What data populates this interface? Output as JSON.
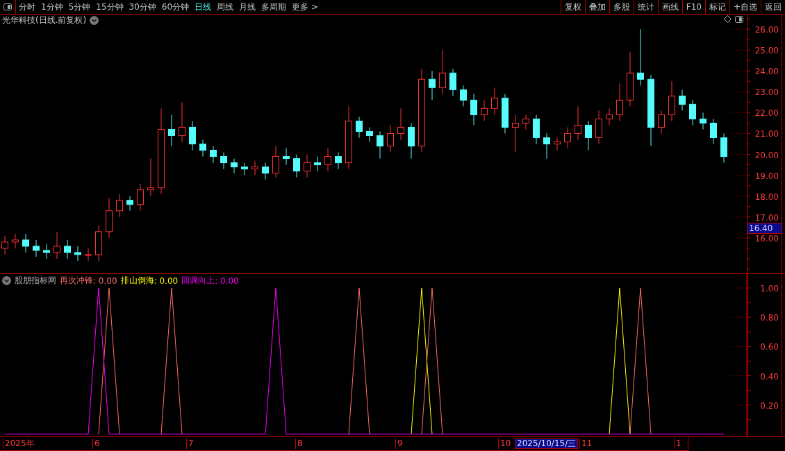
{
  "toolbar": {
    "tabs": [
      {
        "label": "分时",
        "selected": false
      },
      {
        "label": "1分钟",
        "selected": false
      },
      {
        "label": "5分钟",
        "selected": false
      },
      {
        "label": "15分钟",
        "selected": false
      },
      {
        "label": "30分钟",
        "selected": false
      },
      {
        "label": "60分钟",
        "selected": false
      },
      {
        "label": "日线",
        "selected": true
      },
      {
        "label": "周线",
        "selected": false
      },
      {
        "label": "月线",
        "selected": false
      },
      {
        "label": "多周期",
        "selected": false
      },
      {
        "label": "更多 >",
        "selected": false
      }
    ],
    "buttons": [
      "复权",
      "叠加",
      "多股",
      "统计",
      "画线",
      "F10",
      "标记",
      "+自选",
      "返回"
    ]
  },
  "price_panel": {
    "title": "光华科技(日线.前复权)",
    "cursor_price": "16.40",
    "chart_data": {
      "type": "candlestick",
      "ylim": [
        14.3,
        26.7
      ],
      "yticks": [
        {
          "value": 26,
          "label": "26.00"
        },
        {
          "value": 25,
          "label": "25.00"
        },
        {
          "value": 24,
          "label": "24.00"
        },
        {
          "value": 23,
          "label": "23.00"
        },
        {
          "value": 22,
          "label": "22.00"
        },
        {
          "value": 21,
          "label": "21.00"
        },
        {
          "value": 20,
          "label": "20.00"
        },
        {
          "value": 19,
          "label": "19.00"
        },
        {
          "value": 18,
          "label": "18.00"
        },
        {
          "value": 17,
          "label": "17.00"
        },
        {
          "value": 16,
          "label": "16.00"
        }
      ],
      "ohlc": [
        [
          15.5,
          16.1,
          15.2,
          15.8
        ],
        [
          15.8,
          16.2,
          15.5,
          15.9
        ],
        [
          15.9,
          16.2,
          15.3,
          15.6
        ],
        [
          15.6,
          15.9,
          15.1,
          15.4
        ],
        [
          15.4,
          15.7,
          15.0,
          15.3
        ],
        [
          15.3,
          16.3,
          15.0,
          15.6
        ],
        [
          15.6,
          15.9,
          15.0,
          15.3
        ],
        [
          15.3,
          15.6,
          14.9,
          15.2
        ],
        [
          15.2,
          15.5,
          14.9,
          15.2
        ],
        [
          15.2,
          16.6,
          14.9,
          16.3
        ],
        [
          16.3,
          17.9,
          16.0,
          17.3
        ],
        [
          17.3,
          18.1,
          17.0,
          17.8
        ],
        [
          17.8,
          18.0,
          17.3,
          17.6
        ],
        [
          17.6,
          18.6,
          17.3,
          18.3
        ],
        [
          18.3,
          19.8,
          18.0,
          18.4
        ],
        [
          18.4,
          22.2,
          18.1,
          21.2
        ],
        [
          21.2,
          21.9,
          20.4,
          20.9
        ],
        [
          20.9,
          22.5,
          20.6,
          21.3
        ],
        [
          21.3,
          21.6,
          20.2,
          20.5
        ],
        [
          20.5,
          20.7,
          19.9,
          20.2
        ],
        [
          20.2,
          20.4,
          19.6,
          19.9
        ],
        [
          19.9,
          20.1,
          19.3,
          19.6
        ],
        [
          19.6,
          19.8,
          19.1,
          19.4
        ],
        [
          19.4,
          19.6,
          19.0,
          19.3
        ],
        [
          19.3,
          19.7,
          19.0,
          19.4
        ],
        [
          19.4,
          19.6,
          18.8,
          19.1
        ],
        [
          19.1,
          20.4,
          18.9,
          19.9
        ],
        [
          19.9,
          20.3,
          19.5,
          19.8
        ],
        [
          19.8,
          20.0,
          18.9,
          19.2
        ],
        [
          19.2,
          20.0,
          18.9,
          19.6
        ],
        [
          19.6,
          19.9,
          19.2,
          19.5
        ],
        [
          19.5,
          20.3,
          19.2,
          19.9
        ],
        [
          19.9,
          20.1,
          19.3,
          19.6
        ],
        [
          19.6,
          22.3,
          19.3,
          21.6
        ],
        [
          21.6,
          21.8,
          20.8,
          21.1
        ],
        [
          21.1,
          21.3,
          20.6,
          20.9
        ],
        [
          20.9,
          21.1,
          19.8,
          20.4
        ],
        [
          20.4,
          21.4,
          20.1,
          21.0
        ],
        [
          21.0,
          22.2,
          20.7,
          21.3
        ],
        [
          21.3,
          21.5,
          19.8,
          20.4
        ],
        [
          20.4,
          24.1,
          20.1,
          23.6
        ],
        [
          23.6,
          24.0,
          22.6,
          23.2
        ],
        [
          23.2,
          25.0,
          22.9,
          23.9
        ],
        [
          23.9,
          24.1,
          22.8,
          23.1
        ],
        [
          23.1,
          23.3,
          22.3,
          22.6
        ],
        [
          22.6,
          22.9,
          21.4,
          21.9
        ],
        [
          21.9,
          22.6,
          21.6,
          22.2
        ],
        [
          22.2,
          23.2,
          21.9,
          22.7
        ],
        [
          22.7,
          22.9,
          21.0,
          21.3
        ],
        [
          21.3,
          21.9,
          20.1,
          21.5
        ],
        [
          21.5,
          21.9,
          21.2,
          21.7
        ],
        [
          21.7,
          21.9,
          20.5,
          20.8
        ],
        [
          20.8,
          21.0,
          19.8,
          20.5
        ],
        [
          20.5,
          20.8,
          20.2,
          20.6
        ],
        [
          20.6,
          21.3,
          20.3,
          21.0
        ],
        [
          21.0,
          22.3,
          20.7,
          21.4
        ],
        [
          21.4,
          21.6,
          20.2,
          20.8
        ],
        [
          20.8,
          22.1,
          20.5,
          21.7
        ],
        [
          21.7,
          22.2,
          21.4,
          21.9
        ],
        [
          21.9,
          23.4,
          21.6,
          22.6
        ],
        [
          22.6,
          24.9,
          22.3,
          23.9
        ],
        [
          23.9,
          26.0,
          23.3,
          23.6
        ],
        [
          23.6,
          23.8,
          20.4,
          21.3
        ],
        [
          21.3,
          22.1,
          21.0,
          21.9
        ],
        [
          21.9,
          23.5,
          21.6,
          22.8
        ],
        [
          22.8,
          23.1,
          22.1,
          22.4
        ],
        [
          22.4,
          22.6,
          21.4,
          21.7
        ],
        [
          21.7,
          22.0,
          21.2,
          21.5
        ],
        [
          21.5,
          21.7,
          20.5,
          20.8
        ],
        [
          20.8,
          21.0,
          19.6,
          19.9
        ]
      ]
    }
  },
  "indicator_panel": {
    "source": "股朋指标网",
    "readouts": [
      ": 0.00",
      ": 0.00",
      ": 0.00"
    ],
    "chart_data": {
      "type": "line",
      "ylim": [
        -0.015,
        1.095
      ],
      "yticks": [
        {
          "value": 1,
          "label": "1.00"
        },
        {
          "value": 0.8,
          "label": "0.80"
        },
        {
          "value": 0.6,
          "label": "0.60"
        },
        {
          "value": 0.4,
          "label": "0.40"
        },
        {
          "value": 0.2,
          "label": "0.20"
        }
      ],
      "series": [
        {
          "name": "再次冲锋",
          "color": "#ff6e6e",
          "values": [
            null,
            null,
            null,
            null,
            null,
            null,
            null,
            null,
            null,
            0,
            1,
            0,
            null,
            null,
            null,
            0,
            1,
            0,
            null,
            null,
            null,
            null,
            null,
            null,
            null,
            null,
            null,
            null,
            null,
            null,
            null,
            null,
            null,
            0,
            1,
            0,
            null,
            null,
            null,
            null,
            0,
            1,
            0,
            null,
            null,
            null,
            null,
            null,
            null,
            null,
            null,
            null,
            null,
            null,
            null,
            null,
            null,
            null,
            null,
            null,
            0,
            1,
            0,
            null,
            null,
            null,
            null,
            null,
            null,
            null
          ]
        },
        {
          "name": "排山倒海",
          "color": "#ffff00",
          "values": [
            null,
            null,
            null,
            null,
            null,
            null,
            null,
            null,
            null,
            null,
            null,
            null,
            null,
            null,
            null,
            null,
            null,
            null,
            null,
            null,
            null,
            null,
            null,
            null,
            null,
            null,
            null,
            null,
            null,
            null,
            null,
            null,
            null,
            null,
            null,
            null,
            null,
            null,
            null,
            0,
            1,
            0,
            null,
            null,
            null,
            null,
            null,
            null,
            null,
            null,
            null,
            null,
            null,
            null,
            null,
            null,
            null,
            null,
            0,
            1,
            0,
            null,
            null,
            null,
            null,
            null,
            null,
            null,
            null,
            null
          ]
        },
        {
          "name": "回调向上",
          "color": "#ff00ff",
          "values": [
            0,
            0,
            0,
            0,
            0,
            0,
            0,
            0,
            0,
            1,
            0,
            0,
            0,
            0,
            0,
            0,
            0,
            0,
            0,
            0,
            0,
            0,
            0,
            0,
            0,
            0,
            1,
            0,
            0,
            0,
            0,
            0,
            0,
            0,
            0,
            0,
            0,
            0,
            0,
            0,
            0,
            0,
            0,
            0,
            0,
            0,
            0,
            0,
            0,
            0,
            0,
            0,
            0,
            0,
            0,
            0,
            0,
            0,
            0,
            0,
            0,
            0,
            0,
            0,
            0,
            0,
            0,
            0,
            0,
            0
          ]
        }
      ]
    },
    "cursor_date": "2025/10/15/三"
  },
  "date_axis": [
    "2025年",
    "6",
    "7",
    "8",
    "9",
    "10",
    "11",
    "1"
  ]
}
